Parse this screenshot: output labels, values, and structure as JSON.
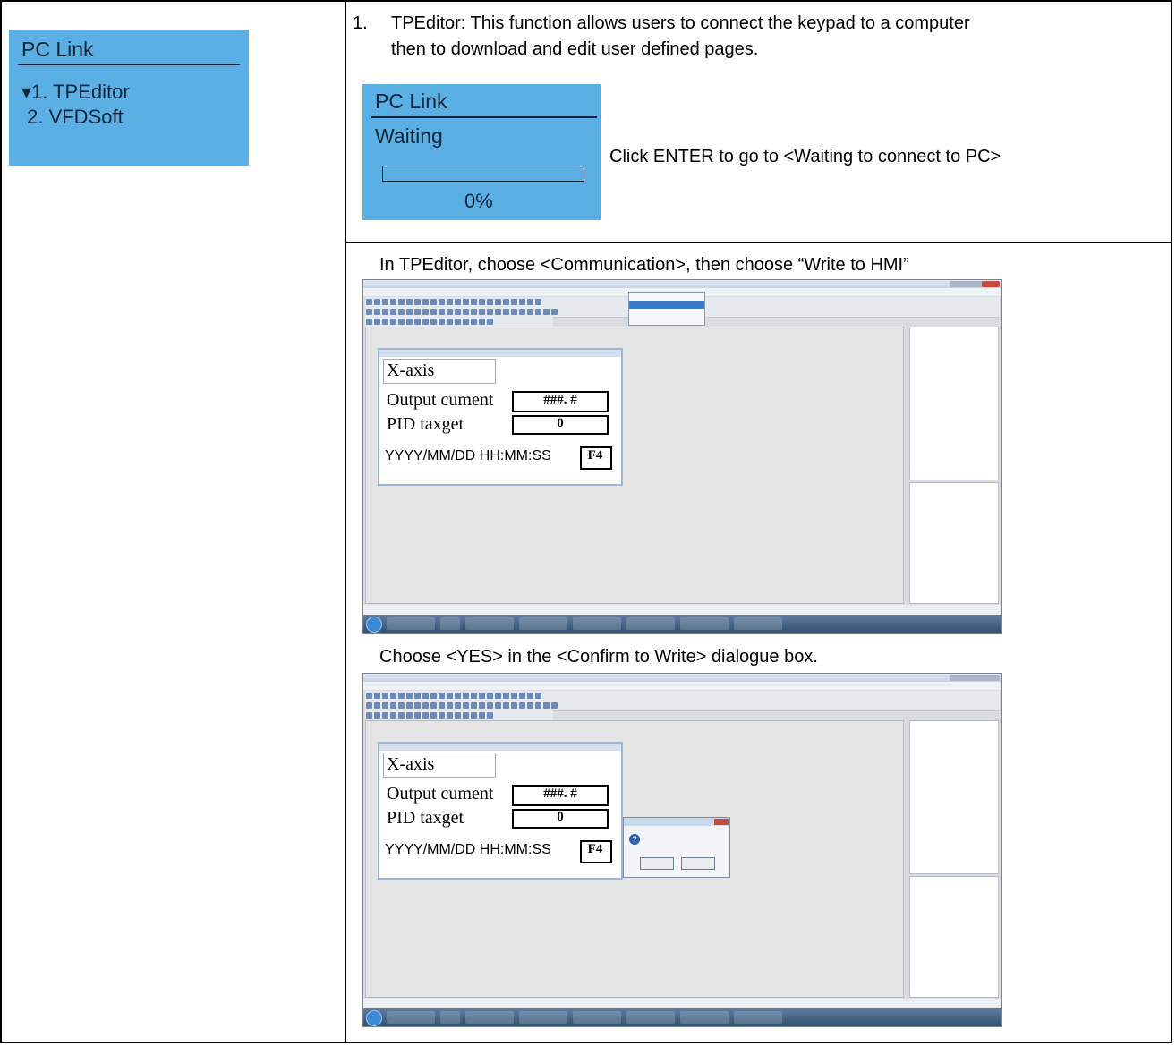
{
  "left_panel": {
    "title": "PC Link",
    "items": [
      "▾1. TPEditor",
      " 2. VFDSoft"
    ]
  },
  "description": {
    "number": "1.",
    "text_line1": "TPEditor: This function allows users to connect the keypad to a computer",
    "text_line2": "then to download and edit user defined pages."
  },
  "waiting_panel": {
    "title": "PC Link",
    "status": "Waiting",
    "progress_label": "0%",
    "progress_value": 0
  },
  "enter_hint": "Click ENTER to go to <Waiting to connect to PC>",
  "step2_text": "In TPEditor, choose <Communication>, then choose “Write to HMI”",
  "step3_text": "Choose <YES> in the <Confirm to Write> dialogue box.",
  "editor": {
    "page_title": "X-axis",
    "row1_label": "Output cument",
    "row1_value": "###. #",
    "row2_label": "PID taxget",
    "row2_value": "0",
    "clock_text": "YYYY/MM/DD HH:MM:SS",
    "fkey": "F4"
  }
}
